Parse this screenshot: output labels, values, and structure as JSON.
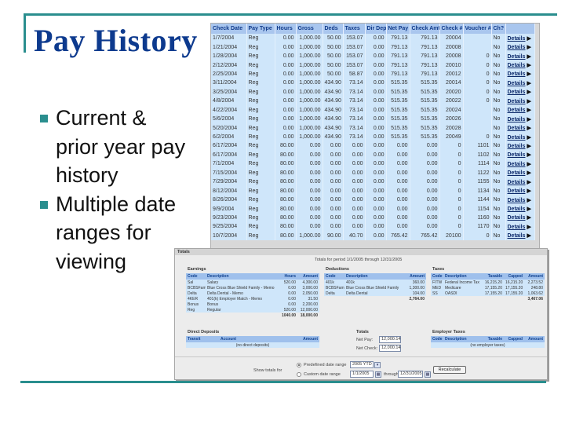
{
  "slide": {
    "title": "Pay History",
    "bullets": [
      "Current & prior year pay history",
      "Multiple date ranges for viewing"
    ],
    "accent_color": "#2a8e8e",
    "title_color": "#0d3a8e"
  },
  "pay_history": {
    "columns": [
      "Check Date",
      "Pay Type",
      "Hours",
      "Gross",
      "Deds",
      "Taxes",
      "Dir Dep",
      "Net Pay",
      "Check Amt",
      "Check #",
      "Voucher #",
      "Ch?",
      ""
    ],
    "link_label": "Details",
    "rows": [
      [
        "1/7/2004",
        "Reg",
        "0.00",
        "1,000.00",
        "50.00",
        "153.07",
        "0.00",
        "791.13",
        "791.13",
        "20004",
        "",
        "No"
      ],
      [
        "1/21/2004",
        "Reg",
        "0.00",
        "1,000.00",
        "50.00",
        "153.07",
        "0.00",
        "791.13",
        "791.13",
        "20008",
        "",
        "No"
      ],
      [
        "1/28/2004",
        "Reg",
        "0.00",
        "1,000.00",
        "50.00",
        "153.07",
        "0.00",
        "791.13",
        "791.13",
        "20008",
        "0",
        "No"
      ],
      [
        "2/12/2004",
        "Reg",
        "0.00",
        "1,000.00",
        "50.00",
        "153.07",
        "0.00",
        "791.13",
        "791.13",
        "20010",
        "0",
        "No"
      ],
      [
        "2/25/2004",
        "Reg",
        "0.00",
        "1,000.00",
        "50.00",
        "58.87",
        "0.00",
        "791.13",
        "791.13",
        "20012",
        "0",
        "No"
      ],
      [
        "3/11/2004",
        "Reg",
        "0.00",
        "1,000.00",
        "434.90",
        "73.14",
        "0.00",
        "515.35",
        "515.35",
        "20014",
        "0",
        "No"
      ],
      [
        "3/25/2004",
        "Reg",
        "0.00",
        "1,000.00",
        "434.90",
        "73.14",
        "0.00",
        "515.35",
        "515.35",
        "20020",
        "0",
        "No"
      ],
      [
        "4/8/2004",
        "Reg",
        "0.00",
        "1,000.00",
        "434.90",
        "73.14",
        "0.00",
        "515.35",
        "515.35",
        "20022",
        "0",
        "No"
      ],
      [
        "4/22/2004",
        "Reg",
        "0.00",
        "1,000.00",
        "434.90",
        "73.14",
        "0.00",
        "515.35",
        "515.35",
        "20024",
        "",
        "No"
      ],
      [
        "5/6/2004",
        "Reg",
        "0.00",
        "1,000.00",
        "434.90",
        "73.14",
        "0.00",
        "515.35",
        "515.35",
        "20026",
        "",
        "No"
      ],
      [
        "5/20/2004",
        "Reg",
        "0.00",
        "1,000.00",
        "434.90",
        "73.14",
        "0.00",
        "515.35",
        "515.35",
        "20028",
        "",
        "No"
      ],
      [
        "6/2/2004",
        "Reg",
        "0.00",
        "1,000.00",
        "434.90",
        "73.14",
        "0.00",
        "515.35",
        "515.35",
        "20049",
        "0",
        "No"
      ],
      [
        "6/17/2004",
        "Reg",
        "80.00",
        "0.00",
        "0.00",
        "0.00",
        "0.00",
        "0.00",
        "0.00",
        "0",
        "1101",
        "No"
      ],
      [
        "6/17/2004",
        "Reg",
        "80.00",
        "0.00",
        "0.00",
        "0.00",
        "0.00",
        "0.00",
        "0.00",
        "0",
        "1102",
        "No"
      ],
      [
        "7/1/2004",
        "Reg",
        "80.00",
        "0.00",
        "0.00",
        "0.00",
        "0.00",
        "0.00",
        "0.00",
        "0",
        "1114",
        "No"
      ],
      [
        "7/15/2004",
        "Reg",
        "80.00",
        "0.00",
        "0.00",
        "0.00",
        "0.00",
        "0.00",
        "0.00",
        "0",
        "1122",
        "No"
      ],
      [
        "7/29/2004",
        "Reg",
        "80.00",
        "0.00",
        "0.00",
        "0.00",
        "0.00",
        "0.00",
        "0.00",
        "0",
        "1155",
        "No"
      ],
      [
        "8/12/2004",
        "Reg",
        "80.00",
        "0.00",
        "0.00",
        "0.00",
        "0.00",
        "0.00",
        "0.00",
        "0",
        "1134",
        "No"
      ],
      [
        "8/26/2004",
        "Reg",
        "80.00",
        "0.00",
        "0.00",
        "0.00",
        "0.00",
        "0.00",
        "0.00",
        "0",
        "1144",
        "No"
      ],
      [
        "9/9/2004",
        "Reg",
        "80.00",
        "0.00",
        "0.00",
        "0.00",
        "0.00",
        "0.00",
        "0.00",
        "0",
        "1154",
        "No"
      ],
      [
        "9/23/2004",
        "Reg",
        "80.00",
        "0.00",
        "0.00",
        "0.00",
        "0.00",
        "0.00",
        "0.00",
        "0",
        "1160",
        "No"
      ],
      [
        "9/25/2004",
        "Reg",
        "80.00",
        "0.00",
        "0.00",
        "0.00",
        "0.00",
        "0.00",
        "0.00",
        "0",
        "1170",
        "No"
      ],
      [
        "10/7/2004",
        "Reg",
        "80.00",
        "1,000.00",
        "90.00",
        "40.70",
        "0.00",
        "765.42",
        "765.42",
        "20100",
        "0",
        "No"
      ]
    ]
  },
  "totals": {
    "header": "Totals",
    "period": "Totals for period 1/1/2005 through 12/31/2005",
    "earnings": {
      "title": "Earnings",
      "columns": [
        "Code",
        "Description",
        "Hours",
        "Amount"
      ],
      "rows": [
        [
          "Sal",
          "Salary",
          "520.00",
          "4,300.00"
        ],
        [
          "BCBSFam",
          "Blue Cross Blue Shield Family - Memo",
          "0.00",
          "3,000.00"
        ],
        [
          "Delta",
          "Delta Dental - Memo",
          "0.00",
          "2,050.00"
        ],
        [
          "4KER",
          "401(k) Employer Match - Memo",
          "0.00",
          "31.50"
        ],
        [
          "Bonus",
          "Bonus",
          "0.00",
          "2,200.00"
        ],
        [
          "Reg",
          "Regular",
          "520.00",
          "12,000.00"
        ]
      ],
      "total_hours": "1040.00",
      "total_amount": "18,000.00"
    },
    "deductions": {
      "title": "Deductions",
      "columns": [
        "Code",
        "Description",
        "Amount"
      ],
      "rows": [
        [
          "401k",
          "401k",
          "360.00"
        ],
        [
          "BCBSFam",
          "Blue Cross Blue Shield Family",
          "1,300.00"
        ],
        [
          "Delta",
          "Delta Dental",
          "104.00"
        ]
      ],
      "total": "2,764.00"
    },
    "taxes": {
      "title": "Taxes",
      "columns": [
        "Code",
        "Description",
        "Taxable",
        "Capped",
        "Amount"
      ],
      "rows": [
        [
          "FITW",
          "Federal Income Tax",
          "16,215.20",
          "16,215.20",
          "2,273.52"
        ],
        [
          "MED",
          "Medicare",
          "17,155.20",
          "17,155.20",
          "248.80"
        ],
        [
          "SS",
          "OASDI",
          "17,155.20",
          "17,155.20",
          "1,063.62"
        ]
      ],
      "total": "3,467.06"
    },
    "direct_deposits": {
      "title": "Direct Deposits",
      "columns": [
        "Transit",
        "Account",
        "Amount"
      ],
      "empty": "(no direct deposits)"
    },
    "summary": {
      "title": "Totals",
      "net_pay_label": "Net Pay:",
      "net_pay": "12,000.14",
      "net_check_label": "Net Check:",
      "net_check": "12,000.14"
    },
    "employer_taxes": {
      "title": "Employer Taxes",
      "columns": [
        "Code",
        "Description",
        "Taxable",
        "Capped",
        "Amount"
      ],
      "empty": "(no employer taxes)"
    },
    "range": {
      "show_label": "Show totals for",
      "predefined_label": "Predefined date range",
      "predefined_value": "2005 YTD",
      "custom_label": "Custom date range",
      "from": "1/1/2005",
      "through_label": "through",
      "to": "12/31/2005",
      "recalc_label": "Recalculate",
      "selected": "predefined"
    }
  }
}
